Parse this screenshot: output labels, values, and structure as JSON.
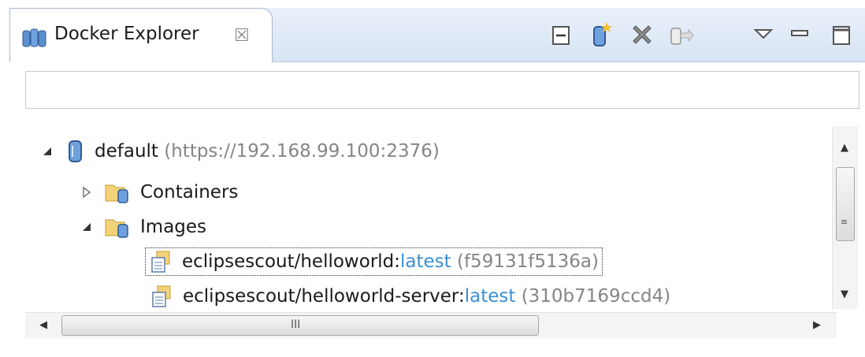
{
  "view": {
    "title": "Docker Explorer",
    "close_glyph": "☒",
    "toolbar": [
      {
        "name": "collapse-all-icon"
      },
      {
        "name": "add-connection-icon"
      },
      {
        "name": "remove-connection-icon"
      },
      {
        "name": "edit-connection-icon"
      },
      {
        "name": "view-menu-icon"
      },
      {
        "name": "minimize-icon"
      },
      {
        "name": "maximize-icon"
      }
    ]
  },
  "search": {
    "value": ""
  },
  "tree": {
    "connection": {
      "name": "default",
      "url": "(https://192.168.99.100:2376)"
    },
    "containers_label": "Containers",
    "images_label": "Images",
    "images": [
      {
        "repo": "eclipsescout/helloworld:",
        "tag": "latest",
        "id": "(f59131f5136a)"
      },
      {
        "repo": "eclipsescout/helloworld-server:",
        "tag": "latest",
        "id": "(310b7169ccd4)"
      }
    ]
  },
  "scroll": {
    "h_grip": "III"
  },
  "colors": {
    "tag": "#3b8fd3",
    "muted": "#858585",
    "tab_bg": "#d8e4f3"
  }
}
